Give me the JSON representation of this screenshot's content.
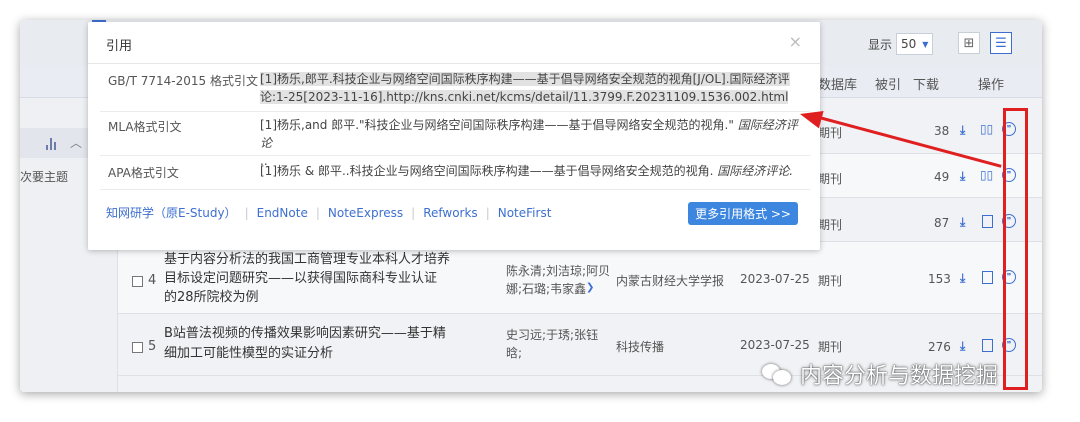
{
  "toolbar": {
    "display_label": "显示",
    "display_value": "50"
  },
  "left_panel": {
    "topic_label": "次要主题"
  },
  "table": {
    "headers": {
      "database": "数据库",
      "cited": "被引",
      "downloads": "下载",
      "actions": "操作"
    },
    "rows": [
      {
        "database": "期刊",
        "downloads": "38"
      },
      {
        "database": "期刊",
        "downloads": "49"
      },
      {
        "database": "期刊",
        "downloads": "87"
      },
      {
        "index": "4",
        "title_line1": "基于内容分析法的我国工商管理专业本科人才培养",
        "title_line2": "目标设定问题研究——以获得国际商科专业认证",
        "title_line3": "的28所院校为例",
        "authors_line1": "陈永清;刘洁琼;阿贝",
        "authors_line2": "娜;石璐;韦家鑫",
        "source": "内蒙古财经大学学报",
        "date": "2023-07-25",
        "database": "期刊",
        "downloads": "153"
      },
      {
        "index": "5",
        "title_line1": "B站普法视频的传播效果影响因素研究——基于精",
        "title_line2": "细加工可能性模型的实证分析",
        "authors_line1": "史习远;于琇;张钰",
        "authors_line2": "晗;",
        "source": "科技传播",
        "date": "2023-07-25",
        "database": "期刊",
        "downloads": "276"
      }
    ]
  },
  "modal": {
    "title": "引用",
    "close_glyph": "×",
    "citations": [
      {
        "label": "GB/T 7714-2015 格式引文",
        "text_line1": "[1]杨乐,郎平.科技企业与网络空间国际秩序构建——基于倡导网络安全规范的视角[J/OL].国际经济评",
        "text_line2": "论:1-25[2023-11-16].http://kns.cnki.net/kcms/detail/11.3799.F.20231109.1536.002.html"
      },
      {
        "label": "MLA格式引文",
        "text_plain": "[1]杨乐,and 郎平.\"科技企业与网络空间国际秩序构建——基于倡导网络安全规范的视角.\" ",
        "text_italic": "国际经济评论",
        "text_line2": ".."
      },
      {
        "label": "APA格式引文",
        "text_plain": "[1]杨乐 & 郎平..科技企业与网络空间国际秩序构建——基于倡导网络安全规范的视角. ",
        "text_italic": "国际经济评论."
      }
    ],
    "footer_links": [
      "知网研学（原E-Study）",
      "EndNote",
      "NoteExpress",
      "Refworks",
      "NoteFirst"
    ],
    "more_button": "更多引用格式 >>"
  },
  "watermark": {
    "text": "内容分析与数据挖掘"
  },
  "colors": {
    "accent": "#3d86e0",
    "annotation": "#e02020"
  }
}
